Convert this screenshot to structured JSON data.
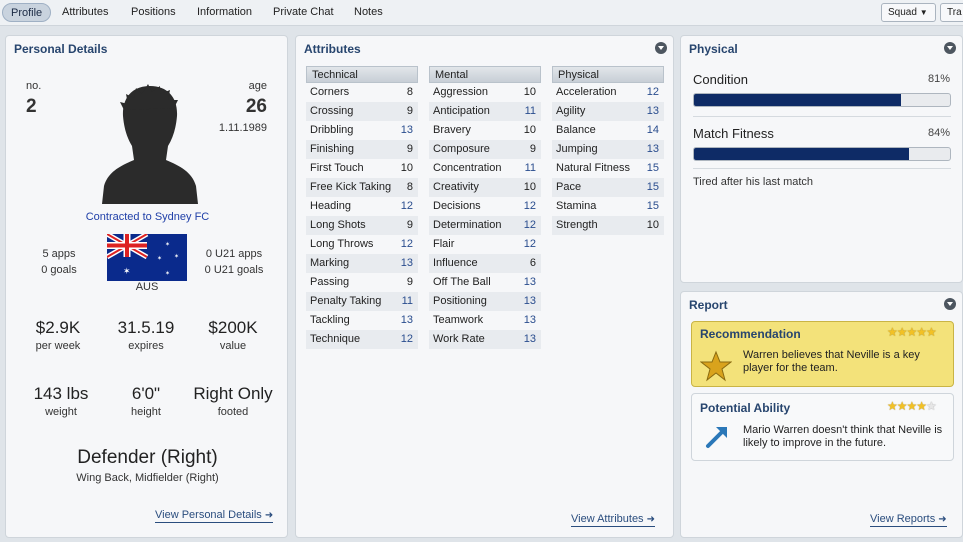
{
  "tabs": [
    "Profile",
    "Attributes",
    "Positions",
    "Information",
    "Private Chat",
    "Notes"
  ],
  "toolbar": {
    "squad_label": "Squad",
    "transfer_label": "Tra"
  },
  "personal": {
    "title": "Personal Details",
    "no_label": "no.",
    "no_value": "2",
    "age_label": "age",
    "age_value": "26",
    "dob": "1.11.1989",
    "contract": "Contracted to Sydney FC",
    "apps": "5 apps",
    "goals": "0 goals",
    "u21_apps": "0 U21 apps",
    "u21_goals": "0 U21 goals",
    "nation": "AUS",
    "wage": "$2.9K",
    "wage_label": "per week",
    "expires": "31.5.19",
    "expires_label": "expires",
    "value": "$200K",
    "value_label": "value",
    "weight": "143 lbs",
    "weight_label": "weight",
    "height": "6'0\"",
    "height_label": "height",
    "foot": "Right Only",
    "foot_label": "footed",
    "position": "Defender (Right)",
    "alt_positions": "Wing Back, Midfielder (Right)",
    "view_link": "View Personal Details"
  },
  "attributes": {
    "title": "Attributes",
    "technical_label": "Technical",
    "mental_label": "Mental",
    "physical_label": "Physical",
    "technical": [
      {
        "name": "Corners",
        "value": "8"
      },
      {
        "name": "Crossing",
        "value": "9"
      },
      {
        "name": "Dribbling",
        "value": "13"
      },
      {
        "name": "Finishing",
        "value": "9"
      },
      {
        "name": "First Touch",
        "value": "10"
      },
      {
        "name": "Free Kick Taking",
        "value": "8"
      },
      {
        "name": "Heading",
        "value": "12"
      },
      {
        "name": "Long Shots",
        "value": "9"
      },
      {
        "name": "Long Throws",
        "value": "12"
      },
      {
        "name": "Marking",
        "value": "13"
      },
      {
        "name": "Passing",
        "value": "9"
      },
      {
        "name": "Penalty Taking",
        "value": "11"
      },
      {
        "name": "Tackling",
        "value": "13"
      },
      {
        "name": "Technique",
        "value": "12"
      }
    ],
    "mental": [
      {
        "name": "Aggression",
        "value": "10"
      },
      {
        "name": "Anticipation",
        "value": "11"
      },
      {
        "name": "Bravery",
        "value": "10"
      },
      {
        "name": "Composure",
        "value": "9"
      },
      {
        "name": "Concentration",
        "value": "11"
      },
      {
        "name": "Creativity",
        "value": "10"
      },
      {
        "name": "Decisions",
        "value": "12"
      },
      {
        "name": "Determination",
        "value": "12"
      },
      {
        "name": "Flair",
        "value": "12"
      },
      {
        "name": "Influence",
        "value": "6"
      },
      {
        "name": "Off The Ball",
        "value": "13"
      },
      {
        "name": "Positioning",
        "value": "13"
      },
      {
        "name": "Teamwork",
        "value": "13"
      },
      {
        "name": "Work Rate",
        "value": "13"
      }
    ],
    "physical": [
      {
        "name": "Acceleration",
        "value": "12"
      },
      {
        "name": "Agility",
        "value": "13"
      },
      {
        "name": "Balance",
        "value": "14"
      },
      {
        "name": "Jumping",
        "value": "13"
      },
      {
        "name": "Natural Fitness",
        "value": "15"
      },
      {
        "name": "Pace",
        "value": "15"
      },
      {
        "name": "Stamina",
        "value": "15"
      },
      {
        "name": "Strength",
        "value": "10"
      }
    ],
    "view_link": "View Attributes"
  },
  "physical": {
    "title": "Physical",
    "condition_label": "Condition",
    "condition_value": "81%",
    "condition_fraction": 0.81,
    "fitness_label": "Match Fitness",
    "fitness_value": "84%",
    "fitness_fraction": 0.84,
    "note": "Tired after his last match"
  },
  "report": {
    "title": "Report",
    "recommendation_title": "Recommendation",
    "recommendation_text": "Warren believes that Neville is a key player for the team.",
    "recommendation_stars": 5,
    "potential_title": "Potential Ability",
    "potential_text": "Mario Warren doesn't think that Neville is likely to improve in the future.",
    "potential_stars": 4,
    "view_link": "View Reports"
  },
  "colors": {
    "accent": "#27456e",
    "bar": "#0e2b66",
    "highlight_value": "#2a4d8e",
    "recommendation_bg": "#f3e27a"
  }
}
